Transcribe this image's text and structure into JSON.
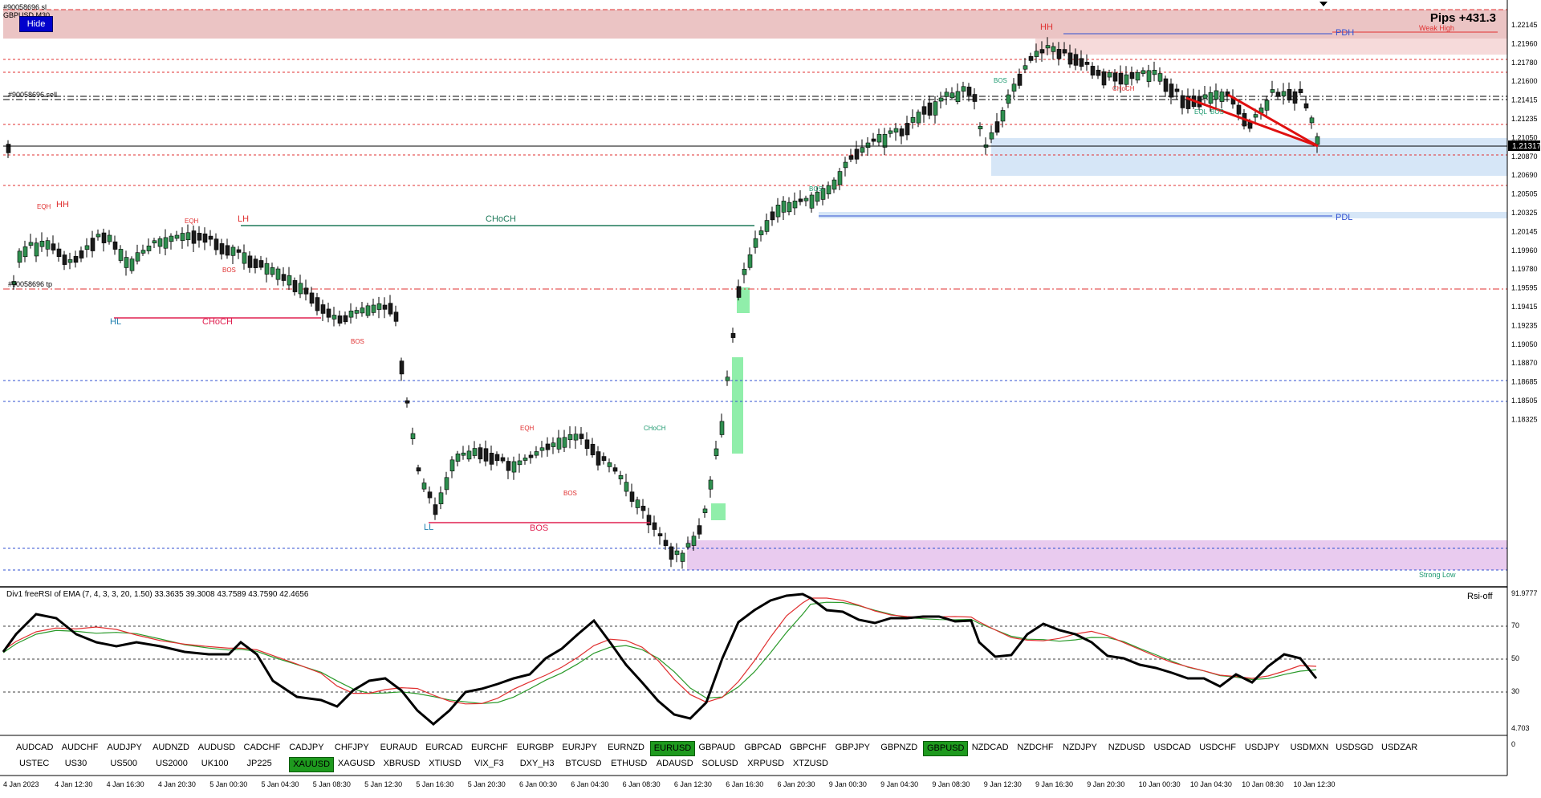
{
  "top_labels": [
    "#90058696 sl",
    "GBPUSD,M30"
  ],
  "hide_button": "Hide",
  "pips": "Pips +431.3",
  "indicator_label": "Div1 freeRSI of EMA (7, 4, 3, 3, 20, 1.50) 33.3635 39.3008 43.7589 43.7590 42.4656",
  "rsi_toggle": "Rsi-off",
  "price_axis": [
    "1.22145",
    "1.21960",
    "1.21780",
    "1.21600",
    "1.21415",
    "1.21235",
    "1.21050",
    "1.20870",
    "1.20690",
    "1.20505",
    "1.20325",
    "1.20145",
    "1.19960",
    "1.19780",
    "1.19595",
    "1.19415",
    "1.19235",
    "1.19050",
    "1.18870",
    "1.18685",
    "1.18505",
    "1.18325"
  ],
  "current_price": "1.21317",
  "rsi_axis": [
    "91.9777",
    "70",
    "50",
    "30",
    "4.703",
    "0"
  ],
  "time_axis": [
    "4 Jan 2023",
    "4 Jan 12:30",
    "4 Jan 16:30",
    "4 Jan 20:30",
    "5 Jan 00:30",
    "5 Jan 04:30",
    "5 Jan 08:30",
    "5 Jan 12:30",
    "5 Jan 16:30",
    "5 Jan 20:30",
    "6 Jan 00:30",
    "6 Jan 04:30",
    "6 Jan 08:30",
    "6 Jan 12:30",
    "6 Jan 16:30",
    "6 Jan 20:30",
    "9 Jan 00:30",
    "9 Jan 04:30",
    "9 Jan 08:30",
    "9 Jan 12:30",
    "9 Jan 16:30",
    "9 Jan 20:30",
    "10 Jan 00:30",
    "10 Jan 04:30",
    "10 Jan 08:30",
    "10 Jan 12:30"
  ],
  "annotations": {
    "hh_left": "HH",
    "eqh_left": "EQH",
    "lh": "LH",
    "eqh2": "EQH",
    "hl": "HL",
    "choch_left": "CHoCH",
    "choch_main": "CHoCH",
    "bos_small1": "BOS",
    "bos_small2": "BOS",
    "ll": "LL",
    "bos_low": "BOS",
    "eqh_mid": "EQH",
    "choch_mid": "CHoCH",
    "bos_mid": "BOS",
    "bos_up": "BOS",
    "hh_right": "HH",
    "bos_right": "BOS",
    "choch_right": "CHoCH",
    "pdh": "PDH",
    "pdl": "PDL",
    "weak_high": "Weak High",
    "strong_low": "Strong Low",
    "sell_label": "#90058696 sell",
    "tp_label": "#90058696 tp",
    "eql": "EQL",
    "bos_r2": "BOS"
  },
  "symbols_row1": [
    "AUDCAD",
    "AUDCHF",
    "AUDJPY",
    "AUDNZD",
    "AUDUSD",
    "CADCHF",
    "CADJPY",
    "CHFJPY",
    "EURAUD",
    "EURCAD",
    "EURCHF",
    "EURGBP",
    "EURJPY",
    "EURNZD",
    "EURUSD",
    "GBPAUD",
    "GBPCAD",
    "GBPCHF",
    "GBPJPY",
    "GBPNZD",
    "GBPUSD",
    "NZDCAD",
    "NZDCHF",
    "NZDJPY",
    "NZDUSD",
    "USDCAD",
    "USDCHF",
    "USDJPY",
    "USDMXN",
    "USDSGD",
    "USDZAR"
  ],
  "symbols_row2": [
    "USTEC",
    "US30",
    "US500",
    "US2000",
    "UK100",
    "JP225",
    "XAUUSD",
    "XAGUSD",
    "XBRUSD",
    "XTIUSD",
    "VIX_F3",
    "DXY_H3",
    "BTCUSD",
    "ETHUSD",
    "ADAUSD",
    "SOLUSD",
    "XRPUSD",
    "XTZUSD"
  ],
  "active_symbols": [
    "EURUSD",
    "GBPUSD",
    "XAUUSD"
  ],
  "colors": {
    "bull": "#2f8f4f",
    "bear": "#1a1a1a",
    "accent": "#1e9a1e",
    "red": "#e03030",
    "blue": "#2040c0"
  }
}
